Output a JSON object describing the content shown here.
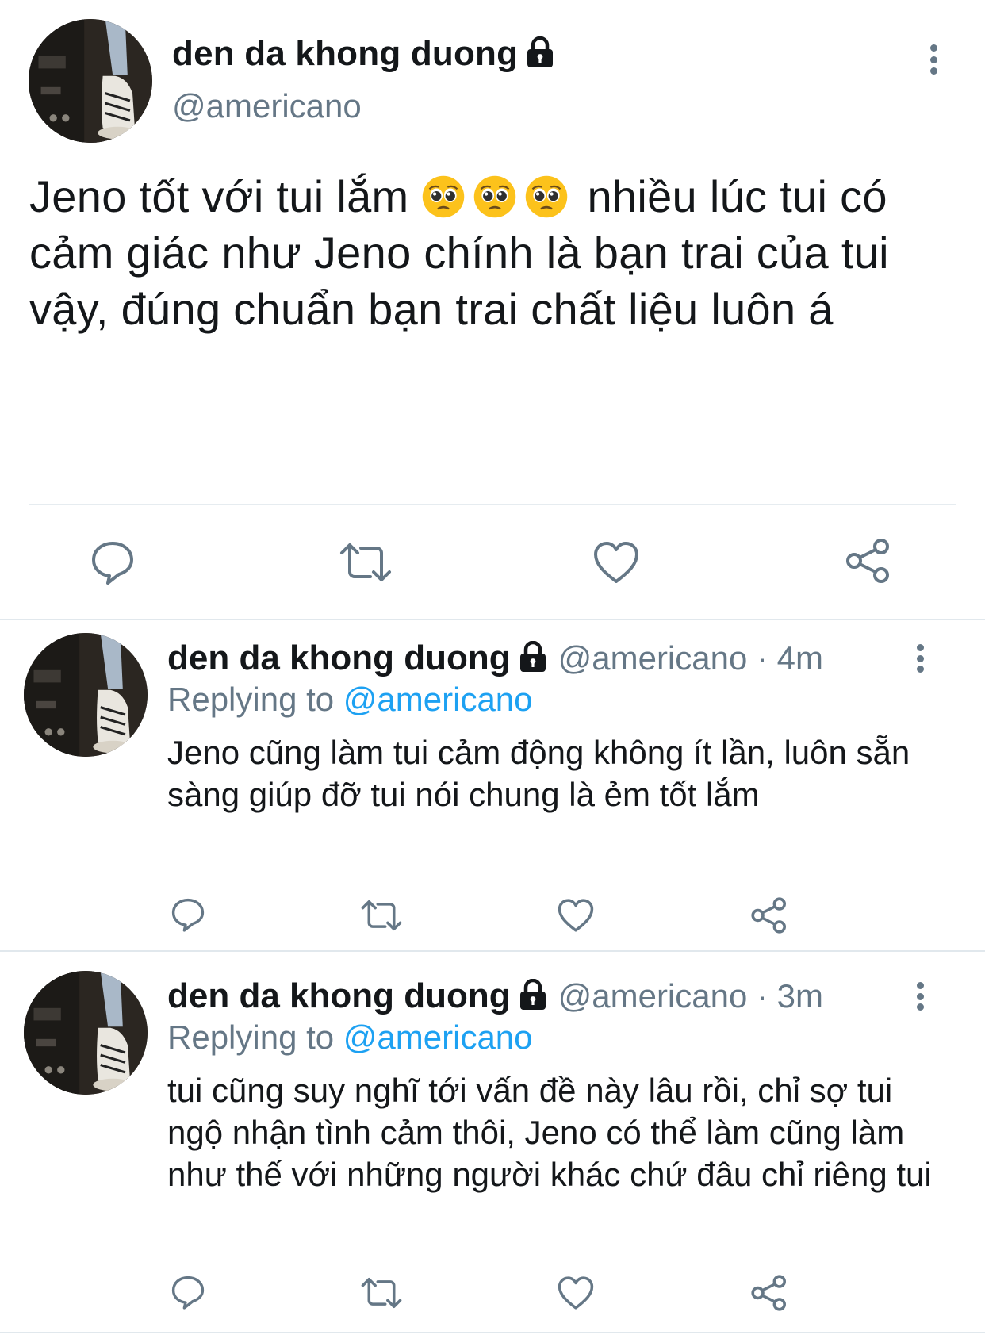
{
  "main_tweet": {
    "author_name": "den da khong duong",
    "handle": "@americano",
    "text_part1": "Jeno tốt với tui lắm",
    "emojis": [
      "pleading-face",
      "pleading-face",
      "pleading-face"
    ],
    "text_part2": "nhiều lúc tui có cảm giác như Jeno chính là bạn trai của tui vậy, đúng chuẩn bạn trai chất liệu luôn á"
  },
  "replies": [
    {
      "author_name": "den da khong duong",
      "handle_time": "@americano · 4m",
      "replying_prefix": "Replying to",
      "replying_mention": "@americano",
      "text": "Jeno cũng làm tui cảm động không ít lần, luôn sẵn sàng giúp đỡ tui nói chung là ẻm tốt lắm"
    },
    {
      "author_name": "den da khong duong",
      "handle_time": "@americano · 3m",
      "replying_prefix": "Replying to",
      "replying_mention": "@americano",
      "text": "tui cũng suy nghĩ tới vấn đề này lâu rồi, chỉ sợ tui ngộ nhận tình cảm thôi, Jeno có thể làm cũng làm như thế với những người khác chứ đâu chỉ riêng tui"
    }
  ],
  "icons": {
    "reply": "reply-icon",
    "retweet": "retweet-icon",
    "like": "like-icon",
    "share": "share-icon",
    "more": "more-icon",
    "lock": "lock-icon"
  },
  "colors": {
    "text": "#14171a",
    "secondary": "#657786",
    "link": "#1da1f2",
    "divider": "#e1e8ed"
  }
}
